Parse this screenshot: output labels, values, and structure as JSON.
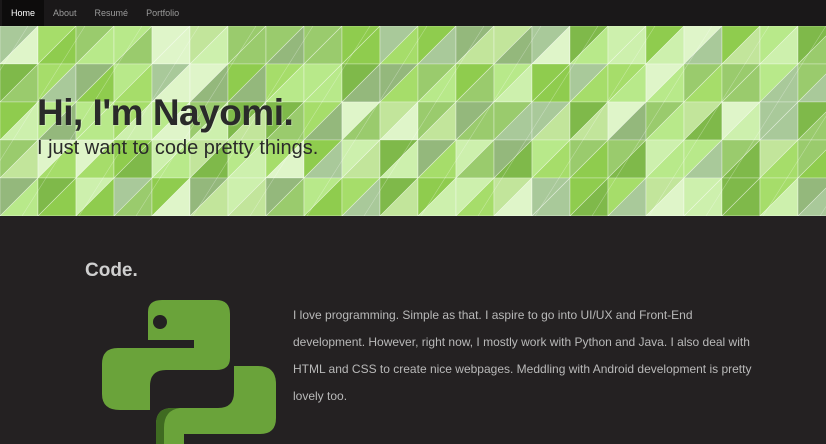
{
  "nav": {
    "items": [
      {
        "label": "Home",
        "active": true
      },
      {
        "label": "About",
        "active": false
      },
      {
        "label": "Resumé",
        "active": false
      },
      {
        "label": "Portfolio",
        "active": false
      }
    ]
  },
  "hero": {
    "title": "Hi, I'm Nayomi.",
    "subtitle": "I just want to code pretty things."
  },
  "code_section": {
    "title": "Code.",
    "body": "I love programming. Simple as that. I aspire to go into UI/UX and Front-End development. However, right now, I mostly work with Python and Java. I also deal with HTML and CSS to create nice webpages. Meddling with Android development is pretty lovely too.",
    "logo_icon": "python-logo-icon"
  },
  "colors": {
    "background": "#242122",
    "navbar": "#1a1819",
    "hero_green": "#a6dd6a",
    "logo_green": "#6aa33a"
  }
}
